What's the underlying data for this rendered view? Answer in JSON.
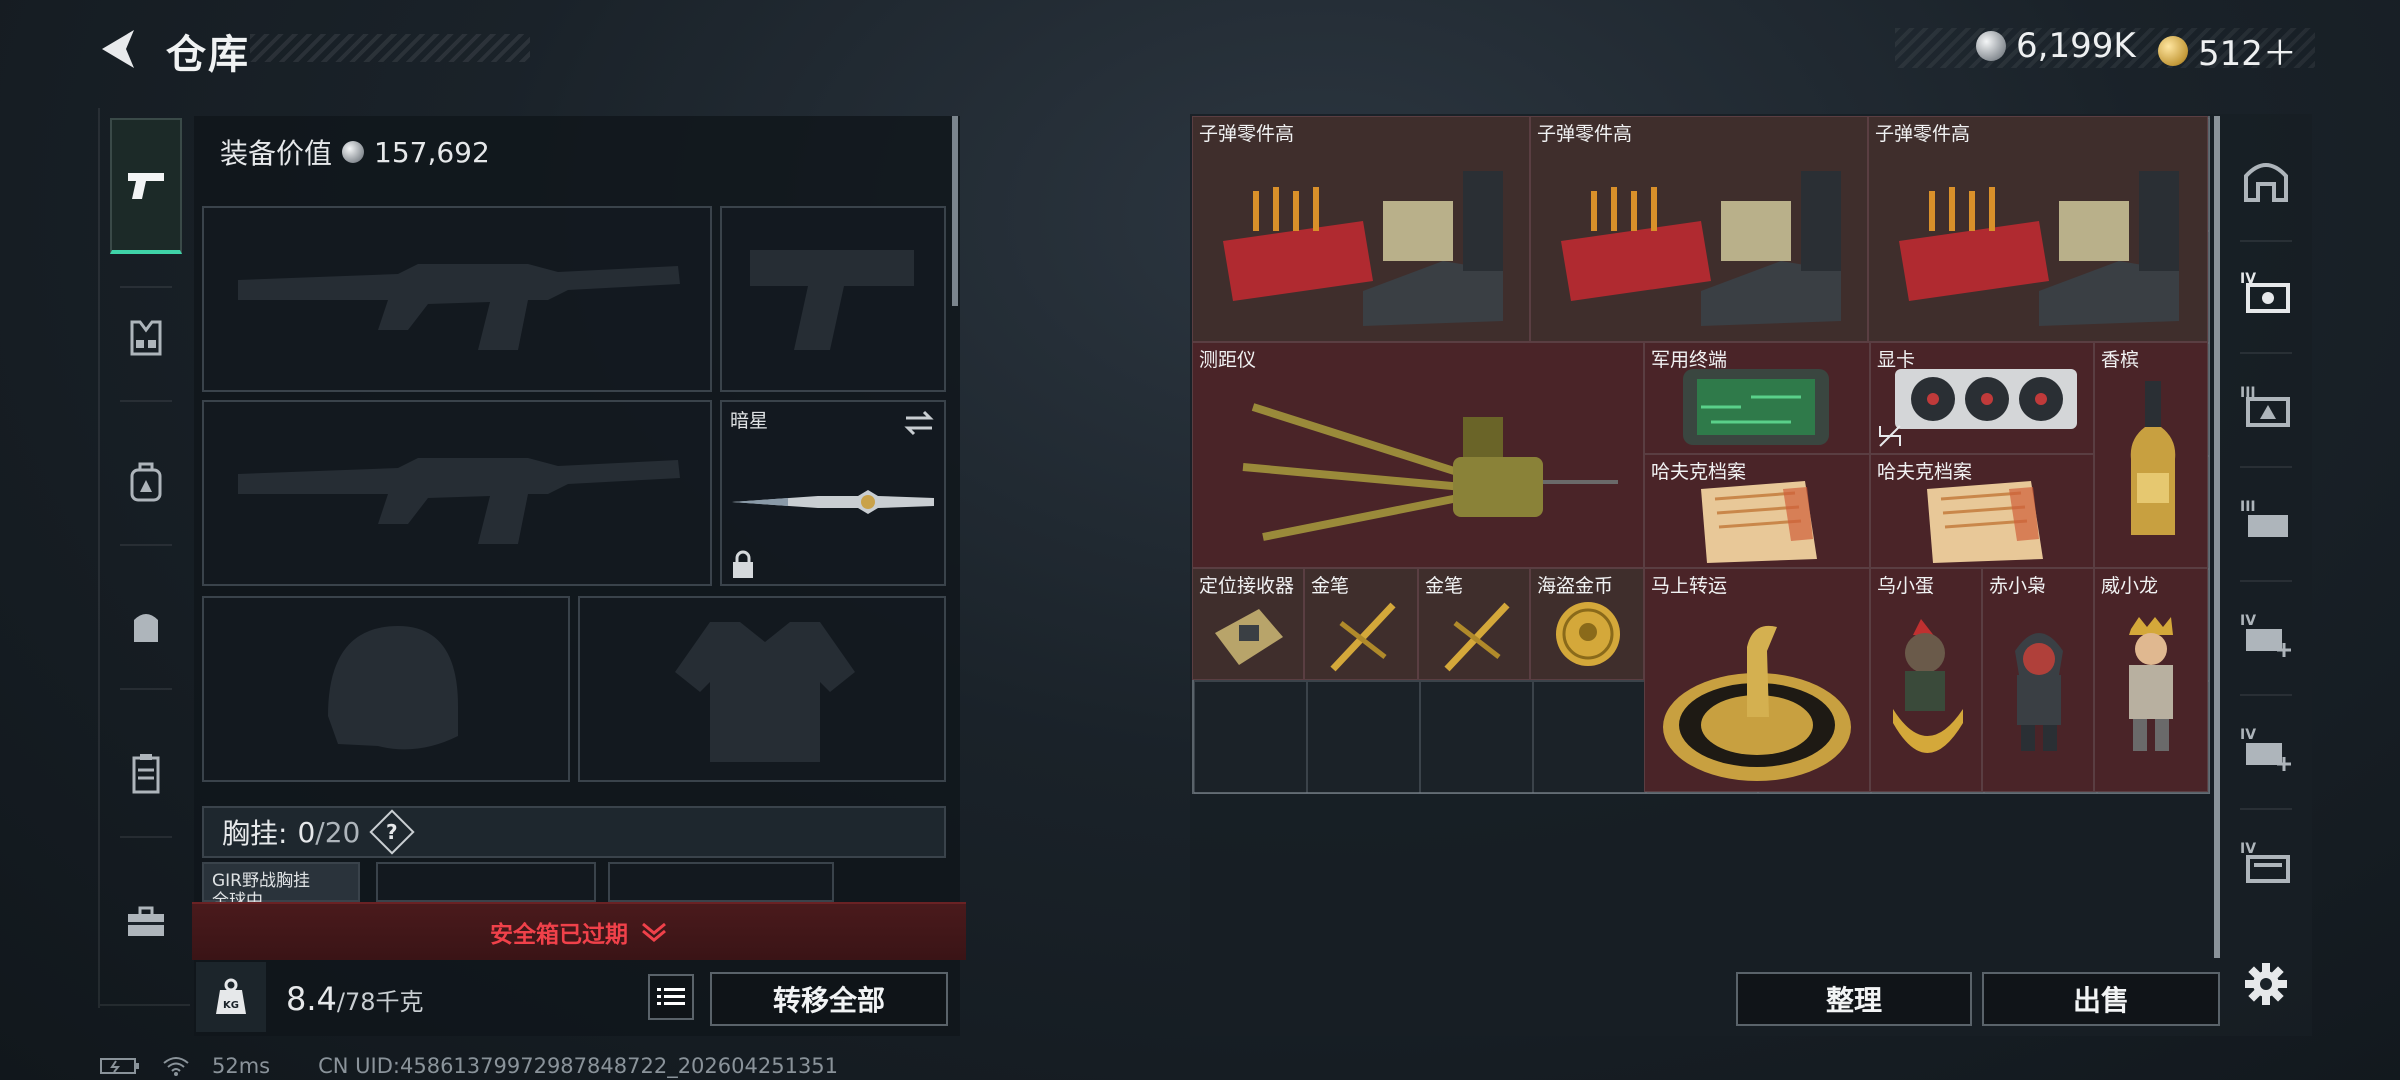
{
  "header": {
    "title": "仓库",
    "currency_silver": "6,199K",
    "currency_gold": "512＋"
  },
  "left_nav": {
    "items": [
      "pistol-icon",
      "vest-icon",
      "backpack-icon",
      "bag-icon",
      "armor-icon",
      "toolbox-icon"
    ],
    "active": "pistol-icon"
  },
  "equipment": {
    "value_label": "装备价值",
    "value": "157,692",
    "melee_label": "暗星",
    "chest_label": "胸挂:",
    "chest_count": "0",
    "chest_capacity": "/20",
    "chest_help": "?",
    "chest_item_label": "GIR野战胸挂",
    "chest_item_sub": "全球中",
    "expired_text": "安全箱已过期",
    "weight": "8.4",
    "weight_unit": "/78千克",
    "transfer_all": "转移全部"
  },
  "inventory": {
    "items": [
      {
        "label": "子弹零件高",
        "color": "brown"
      },
      {
        "label": "子弹零件高",
        "color": "brown"
      },
      {
        "label": "子弹零件高",
        "color": "brown"
      },
      {
        "label": "测距仪",
        "color": "red"
      },
      {
        "label": "军用终端",
        "color": "red"
      },
      {
        "label": "显卡",
        "color": "red"
      },
      {
        "label": "香槟",
        "color": "red"
      },
      {
        "label": "哈夫克档案",
        "color": "red"
      },
      {
        "label": "哈夫克档案",
        "color": "red"
      },
      {
        "label": "定位接收器",
        "color": "brown"
      },
      {
        "label": "金笔",
        "color": "brown"
      },
      {
        "label": "金笔",
        "color": "brown"
      },
      {
        "label": "海盗金币",
        "color": "brown"
      },
      {
        "label": "马上转运",
        "color": "red"
      },
      {
        "label": "乌小蛋",
        "color": "red"
      },
      {
        "label": "赤小枭",
        "color": "red"
      },
      {
        "label": "威小龙",
        "color": "red"
      }
    ],
    "sort_button": "整理",
    "sell_button": "出售"
  },
  "right_nav": {
    "items": [
      "safehouse-icon",
      "container-iv-icon",
      "container-iii-icon",
      "case-iii-icon",
      "case-iv-add-icon",
      "case-iv-add-icon",
      "box-iv-icon"
    ],
    "settings": "gear-icon"
  },
  "status_bar": {
    "ping": "52ms",
    "uid": "CN UID:45861379972987848722_202604251351"
  }
}
